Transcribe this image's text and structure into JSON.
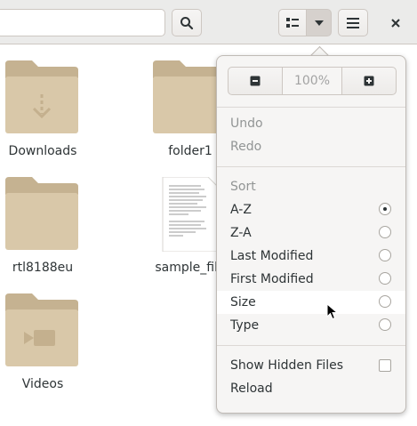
{
  "header": {
    "search_placeholder": "",
    "icons": {
      "search": "search-icon",
      "view_list": "list-view-icon",
      "view_menu": "dropdown-icon",
      "main_menu": "hamburger-menu-icon",
      "close": "close-icon"
    }
  },
  "files": [
    {
      "name": "Downloads",
      "type": "folder",
      "emblem": "download"
    },
    {
      "name": "folder1",
      "type": "folder"
    },
    {
      "name": "rtl8188eu",
      "type": "folder"
    },
    {
      "name": "sample_file",
      "type": "document"
    },
    {
      "name": "Videos",
      "type": "folder",
      "emblem": "video"
    }
  ],
  "view_menu": {
    "zoom_level": "100%",
    "undo": "Undo",
    "redo": "Redo",
    "sort_heading": "Sort",
    "sort_options": [
      {
        "label": "A-Z",
        "selected": true
      },
      {
        "label": "Z-A",
        "selected": false
      },
      {
        "label": "Last Modified",
        "selected": false
      },
      {
        "label": "First Modified",
        "selected": false
      },
      {
        "label": "Size",
        "selected": false
      },
      {
        "label": "Type",
        "selected": false
      }
    ],
    "show_hidden": "Show Hidden Files",
    "show_hidden_checked": false,
    "reload": "Reload"
  },
  "colors": {
    "folder": "#d9c8a9",
    "folder_dark": "#c5b291",
    "header_bg": "#ebebea",
    "popover_bg": "#f6f5f4"
  }
}
